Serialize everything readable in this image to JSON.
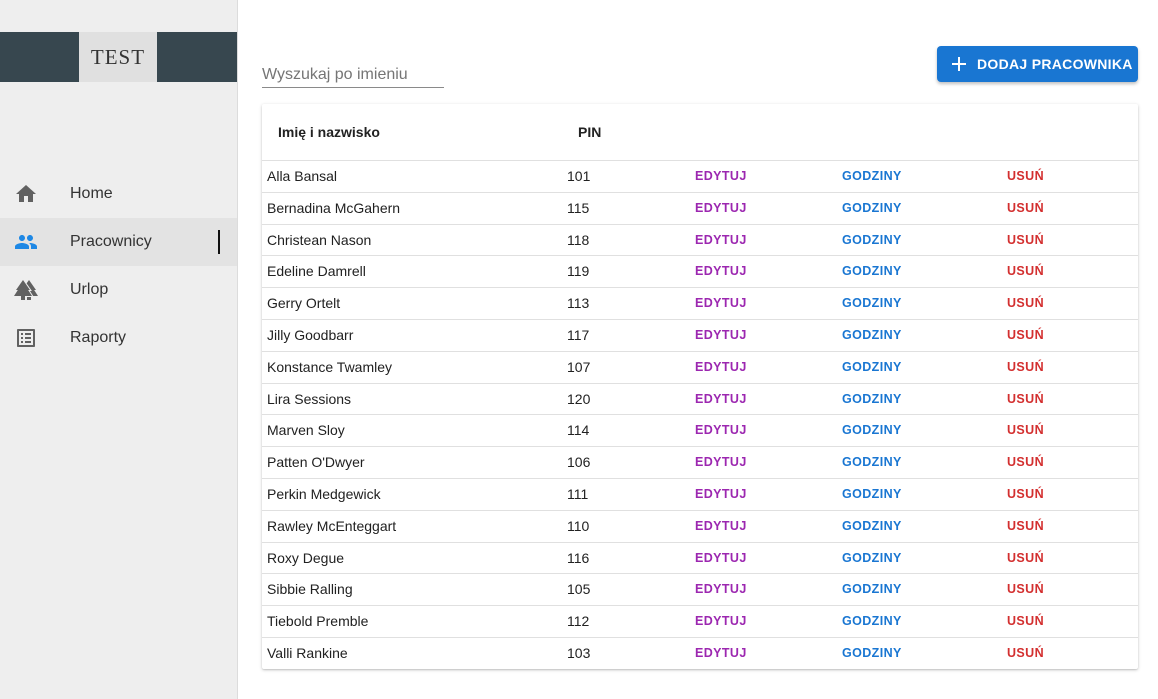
{
  "sidebar": {
    "logo_text": "TEST",
    "items": [
      {
        "label": "Home",
        "icon": "home-icon",
        "active": false
      },
      {
        "label": "Pracownicy",
        "icon": "people-icon",
        "active": true
      },
      {
        "label": "Urlop",
        "icon": "trees-icon",
        "active": false
      },
      {
        "label": "Raporty",
        "icon": "list-report-icon",
        "active": false
      }
    ]
  },
  "search": {
    "placeholder": "Wyszukaj po imieniu",
    "value": ""
  },
  "add_button": {
    "label": "DODAJ PRACOWNIKA",
    "icon": "plus-icon"
  },
  "table": {
    "headers": {
      "name": "Imię i nazwisko",
      "pin": "PIN"
    },
    "actions": {
      "edit": "EDYTUJ",
      "hours": "GODZINY",
      "delete": "USUŃ"
    },
    "rows": [
      {
        "name": "Alla Bansal",
        "pin": "101"
      },
      {
        "name": "Bernadina McGahern",
        "pin": "115"
      },
      {
        "name": "Christean Nason",
        "pin": "118"
      },
      {
        "name": "Edeline Damrell",
        "pin": "119"
      },
      {
        "name": "Gerry Ortelt",
        "pin": "113"
      },
      {
        "name": "Jilly Goodbarr",
        "pin": "117"
      },
      {
        "name": "Konstance Twamley",
        "pin": "107"
      },
      {
        "name": "Lira Sessions",
        "pin": "120"
      },
      {
        "name": "Marven Sloy",
        "pin": "114"
      },
      {
        "name": "Patten O'Dwyer",
        "pin": "106"
      },
      {
        "name": "Perkin Medgewick",
        "pin": "111"
      },
      {
        "name": "Rawley McEnteggart",
        "pin": "110"
      },
      {
        "name": "Roxy Degue",
        "pin": "116"
      },
      {
        "name": "Sibbie Ralling",
        "pin": "105"
      },
      {
        "name": "Tiebold Premble",
        "pin": "112"
      },
      {
        "name": "Valli Rankine",
        "pin": "103"
      }
    ]
  },
  "colors": {
    "primary": "#1976d2",
    "edit": "#9c27b0",
    "delete": "#d32f2f",
    "logo_bar": "#37474f",
    "sidebar_bg": "#eeeeee"
  }
}
